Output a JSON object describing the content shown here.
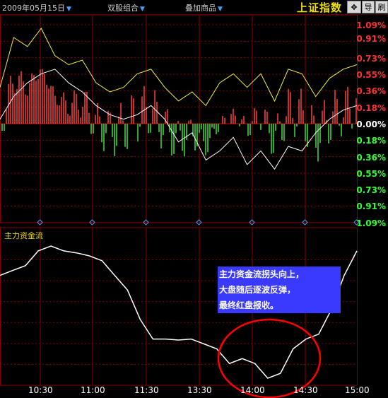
{
  "toolbar": {
    "date_label": "2009年05月15日",
    "dual_stock_label": "双股组合",
    "overlay_label": "叠加商品",
    "index_title": "上证指数",
    "btn_move": "✥",
    "btn_import": "导",
    "btn_refresh": "刷"
  },
  "price_axis": {
    "labels_up": [
      "1.09%",
      "0.91%",
      "0.73%",
      "0.55%",
      "0.36%",
      "0.18%"
    ],
    "zero": "0.00%",
    "labels_down": [
      "0.18%",
      "0.36%",
      "0.55%",
      "0.73%",
      "0.91%",
      "1.09%"
    ]
  },
  "lower_panel": {
    "title": "主力资金流",
    "annotation": [
      "主力资金流拐头向上，",
      "大盘随后逐波反弹，",
      "最终红盘报收。"
    ]
  },
  "time_axis": [
    "10:30",
    "11:00",
    "11:30",
    "13:30",
    "14:00",
    "14:30",
    "15:00"
  ],
  "colors": {
    "up_bar": "#ff4040",
    "down_bar": "#40e040",
    "price_line": "#ffffff",
    "avg_line": "#f0f040",
    "flow_line": "#ffffff",
    "grid": "#8a0000",
    "circle": "#ff0000"
  },
  "chart_data": [
    {
      "type": "line",
      "title": "",
      "ylim": [
        -1.09,
        1.09
      ],
      "x_ticks": [
        "10:30",
        "11:00",
        "11:30",
        "13:30",
        "14:00",
        "14:30",
        "15:00"
      ],
      "series": [
        {
          "values": [
            0.4,
            0.95,
            0.85,
            1.05,
            0.75,
            0.65,
            0.7,
            0.45,
            0.35,
            0.4,
            0.55,
            0.6,
            0.4,
            0.25,
            0.35,
            0.2,
            0.45,
            0.55,
            0.4,
            0.55,
            0.25,
            0.6,
            0.55,
            0.3,
            0.5,
            0.6,
            0.65
          ]
        },
        {
          "values": [
            0.05,
            0.3,
            0.45,
            0.55,
            0.6,
            0.45,
            0.35,
            0.2,
            0.1,
            0.05,
            0.1,
            0.2,
            0.05,
            -0.2,
            -0.1,
            -0.4,
            -0.3,
            -0.15,
            -0.45,
            -0.3,
            -0.5,
            -0.25,
            -0.3,
            -0.1,
            0.05,
            0.15,
            0.2
          ]
        }
      ]
    },
    {
      "type": "line",
      "title": "主力资金流",
      "x_ticks": [
        "10:30",
        "11:00",
        "11:30",
        "13:30",
        "14:00",
        "14:30",
        "15:00"
      ],
      "series": [
        {
          "values": [
            0.7,
            0.75,
            0.8,
            0.95,
            1.0,
            0.95,
            0.93,
            0.9,
            0.85,
            0.7,
            0.55,
            0.25,
            0.05,
            0.05,
            0.04,
            0.05,
            0.0,
            -0.05,
            -0.2,
            -0.15,
            -0.2,
            -0.35,
            -0.3,
            -0.05,
            0.05,
            0.1,
            0.35,
            0.7,
            0.95
          ]
        }
      ]
    }
  ]
}
